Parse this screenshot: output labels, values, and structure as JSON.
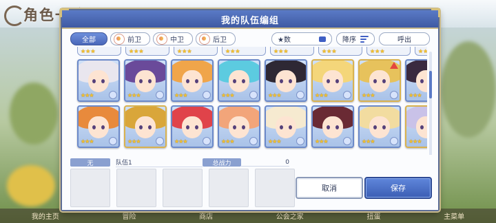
{
  "background": {
    "title": "角色一览",
    "nav_items": [
      "我的主页",
      "冒险",
      "商店",
      "公会之家",
      "扭蛋",
      "主菜单"
    ]
  },
  "dialog": {
    "title": "我的队伍编组"
  },
  "filters": {
    "tabs": [
      "全部",
      "前卫",
      "中卫",
      "后卫"
    ],
    "active_tab": "全部"
  },
  "sort": {
    "star_label": "★数",
    "order_label": "降序",
    "call_label": "呼出"
  },
  "characters": {
    "peek_row": [
      "★★★",
      "★★★",
      "★★★",
      "★★★",
      "★★★",
      "★★★",
      "★★★",
      "★★★"
    ],
    "row1": [
      {
        "stars": "★★★",
        "hair": "#e9e6ee"
      },
      {
        "stars": "★★★",
        "hair": "#6a4a9a"
      },
      {
        "stars": "★★★",
        "hair": "#f0a54a"
      },
      {
        "stars": "★★★",
        "hair": "#5ccbe0"
      },
      {
        "stars": "★★★",
        "hair": "#2e2834"
      },
      {
        "stars": "★★★",
        "hair": "#f4d67a"
      },
      {
        "stars": "★★★",
        "hair": "#e7c25c"
      },
      {
        "stars": "★★★",
        "hair": "#3a2a40"
      }
    ],
    "row2": [
      {
        "stars": "★★★",
        "hair": "#e88a3c"
      },
      {
        "stars": "★★★",
        "hair": "#d9a63a"
      },
      {
        "stars": "★★★",
        "hair": "#e0434a"
      },
      {
        "stars": "★★★",
        "hair": "#f2a57a"
      },
      {
        "stars": "★★★",
        "hair": "#f6ead0"
      },
      {
        "stars": "★★★",
        "hair": "#6a2a34"
      },
      {
        "stars": "★★★",
        "hair": "#f2dca0"
      },
      {
        "stars": "★★★",
        "hair": "#c9c2e8"
      }
    ]
  },
  "party": {
    "tag": "无",
    "name": "队伍1",
    "power_label": "总战力",
    "power_value": "0",
    "cancel_label": "取消",
    "save_label": "保存"
  },
  "colors": {
    "accent": "#4a67b8",
    "titlebar": "#3f5aa3",
    "gold_frame": "#c9b98a",
    "star": "#f5c22c"
  }
}
